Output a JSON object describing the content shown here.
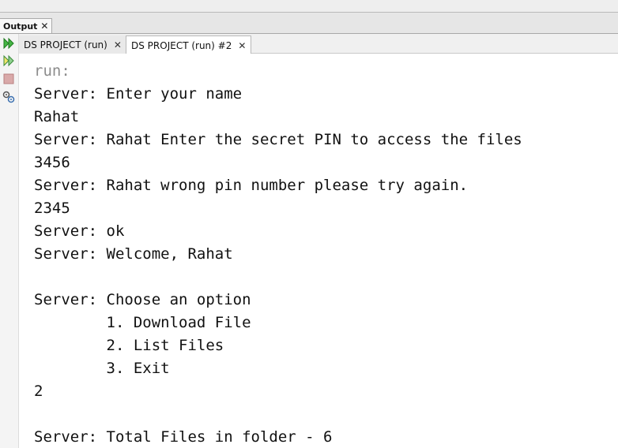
{
  "panel": {
    "tab_label": "Output",
    "close_glyph": "✕"
  },
  "toolbar": {
    "icons": [
      "rerun-icon",
      "rerun-with-args-icon",
      "stop-icon",
      "settings-icon"
    ]
  },
  "subtabs": [
    {
      "label": "DS PROJECT (run)",
      "close": "✕",
      "active": false
    },
    {
      "label": "DS PROJECT (run) #2",
      "close": "✕",
      "active": true
    }
  ],
  "console": {
    "lines": [
      "run:",
      "Server: Enter your name",
      "Rahat",
      "Server: Rahat Enter the secret PIN to access the files",
      "3456",
      "Server: Rahat wrong pin number please try again.",
      "2345",
      "Server: ok",
      "Server: Welcome, Rahat",
      "",
      "Server: Choose an option",
      "        1. Download File",
      "        2. List Files",
      "        3. Exit",
      "2",
      "",
      "Server: Total Files in folder - 6"
    ]
  },
  "colors": {
    "run_text": "#8c8c8c",
    "text": "#111111",
    "rerun_green": "#3aa33a",
    "stop_red": "#c98a8a"
  }
}
